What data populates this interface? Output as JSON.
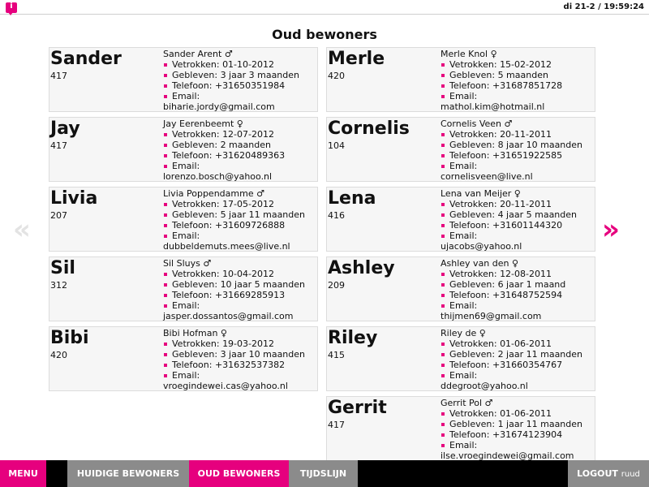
{
  "header": {
    "logo_glyph": "i",
    "clock": "di 21-2 / 19:59:24"
  },
  "page_title": "Oud bewoners",
  "labels": {
    "moved_out": "Vetrokken: ",
    "born": "Gebleven: ",
    "phone": "Telefoon: ",
    "email": "Email:"
  },
  "left_cards": [
    {
      "name": "Sander",
      "room": "417",
      "fullname": "Sander Arent ♂",
      "moved_out": "01-10-2012",
      "born": "3 jaar 3 maanden",
      "phone": "+31650351984",
      "email": "biharie.jordy@gmail.com"
    },
    {
      "name": "Jay",
      "room": "417",
      "fullname": "Jay Eerenbeemt ♀",
      "moved_out": "12-07-2012",
      "born": "2 maanden",
      "phone": "+31620489363",
      "email": "lorenzo.bosch@yahoo.nl"
    },
    {
      "name": "Livia",
      "room": "207",
      "fullname": "Livia Poppendamme ♂",
      "moved_out": "17-05-2012",
      "born": "5 jaar 11 maanden",
      "phone": "+31609726888",
      "email": "dubbeldemuts.mees@live.nl"
    },
    {
      "name": "Sil",
      "room": "312",
      "fullname": "Sil Sluys ♂",
      "moved_out": "10-04-2012",
      "born": "10 jaar 5 maanden",
      "phone": "+31669285913",
      "email": "jasper.dossantos@gmail.com"
    },
    {
      "name": "Bibi",
      "room": "420",
      "fullname": "Bibi Hofman ♀",
      "moved_out": "19-03-2012",
      "born": "3 jaar 10 maanden",
      "phone": "+31632537382",
      "email": "vroegindewei.cas@yahoo.nl"
    }
  ],
  "right_cards": [
    {
      "name": "Merle",
      "room": "420",
      "fullname": "Merle Knol ♀",
      "moved_out": "15-02-2012",
      "born": "5 maanden",
      "phone": "+31687851728",
      "email": "mathol.kim@hotmail.nl"
    },
    {
      "name": "Cornelis",
      "room": "104",
      "fullname": "Cornelis Veen ♂",
      "moved_out": "20-11-2011",
      "born": "8 jaar 10 maanden",
      "phone": "+31651922585",
      "email": "cornelisveen@live.nl"
    },
    {
      "name": "Lena",
      "room": "416",
      "fullname": "Lena van Meijer ♀",
      "moved_out": "20-11-2011",
      "born": "4 jaar 5 maanden",
      "phone": "+31601144320",
      "email": "ujacobs@yahoo.nl"
    },
    {
      "name": "Ashley",
      "room": "209",
      "fullname": "Ashley van den ♀",
      "moved_out": "12-08-2011",
      "born": "6 jaar 1 maand",
      "phone": "+31648752594",
      "email": "thijmen69@gmail.com"
    },
    {
      "name": "Riley",
      "room": "415",
      "fullname": "Riley de ♀",
      "moved_out": "01-06-2011",
      "born": "2 jaar 11 maanden",
      "phone": "+31660354767",
      "email": "ddegroot@yahoo.nl"
    },
    {
      "name": "Gerrit",
      "room": "417",
      "fullname": "Gerrit Pol ♂",
      "moved_out": "01-06-2011",
      "born": "1 jaar 11 maanden",
      "phone": "+31674123904",
      "email": "ilse.vroegindewei@gmail.com"
    }
  ],
  "pager": {
    "prev": "«",
    "next": "»"
  },
  "nav": {
    "menu": "MENU",
    "current": "HUIDIGE BEWONERS",
    "old": "OUD BEWONERS",
    "timeline": "TIJDSLIJN",
    "logout": "LOGOUT",
    "user": "ruud"
  },
  "colors": {
    "accent": "#e6007e",
    "nav_gray": "#8b8b8b",
    "bar_black": "#000000",
    "card_bg": "#f6f6f6"
  }
}
